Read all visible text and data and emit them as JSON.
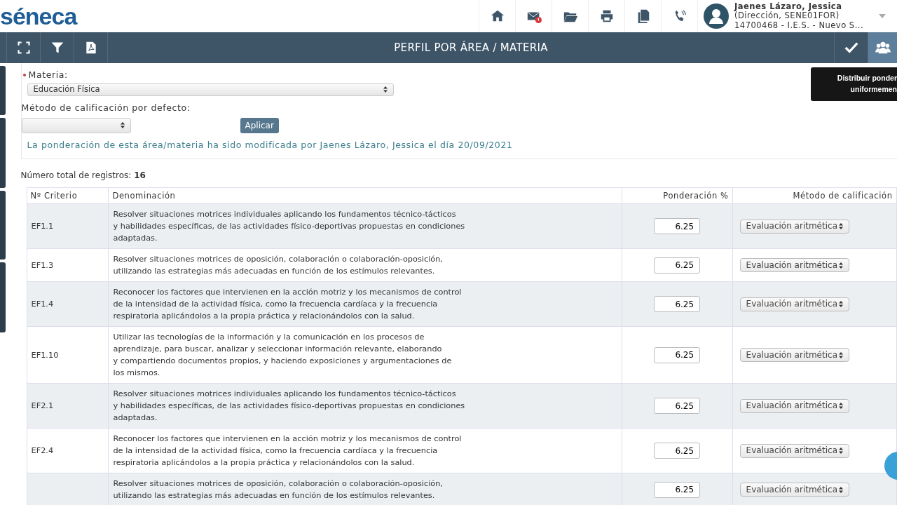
{
  "header": {
    "logo": "séneca",
    "icons": [
      {
        "kind": "home"
      },
      {
        "kind": "mail"
      },
      {
        "kind": "folder"
      },
      {
        "kind": "print"
      },
      {
        "kind": "copy"
      },
      {
        "kind": "phone"
      }
    ],
    "user": {
      "name": "Jaenes Lázaro, Jessica",
      "role": "(Dirección, SENE01FOR)",
      "center": "14700468 - I.E.S. - Nuevo S..."
    }
  },
  "toolbar": {
    "left_icons": [
      {
        "kind": "expand"
      },
      {
        "kind": "filter"
      },
      {
        "kind": "pdf"
      }
    ],
    "title": "PERFIL POR ÁREA / MATERIA",
    "right_icons": [
      {
        "kind": "check",
        "selected": false
      },
      {
        "kind": "users",
        "selected": true
      }
    ],
    "tooltip": [
      "Distribuir ponder",
      "uniformemen"
    ]
  },
  "form": {
    "materia_label": "Materia:",
    "materia_value": "Educación Física",
    "method_label": "Método de calificación por defecto:",
    "apply_button": "Aplicar",
    "notice": "La ponderación de esta área/materia ha sido modificada por Jaenes Lázaro, Jessica el día 20/09/2021"
  },
  "records": "Número total de registros: **16**",
  "table": {
    "columns": [
      "Nº Criterio",
      "Denominación",
      "Ponderación %",
      "Método de calificación"
    ],
    "rows": [
      {
        "criterio": "EF1.1",
        "denominacion": "Resolver situaciones motrices individuales aplicando los fundamentos técnico-tácticos\ny habilidades específicas, de las actividades físico-deportivas propuestas en condiciones\nadaptadas.",
        "ponderacion": "6.25",
        "metodo": "Evaluación aritmética"
      },
      {
        "criterio": "EF1.3",
        "denominacion": "Resolver situaciones motrices de oposición, colaboración o colaboración-oposición,\nutilizando las estrategias más adecuadas en función de los estímulos relevantes.",
        "ponderacion": "6.25",
        "metodo": "Evaluación aritmética"
      },
      {
        "criterio": "EF1.4",
        "denominacion": "Reconocer los factores que intervienen en la acción motriz y los mecanismos de control\nde la intensidad de la actividad física, como la frecuencia cardíaca y la frecuencia\nrespiratoria aplicándolos a la propia práctica y relacionándolos con la salud.",
        "ponderacion": "6.25",
        "metodo": "Evaluación aritmética"
      },
      {
        "criterio": "EF1.10",
        "denominacion": "Utilizar las tecnologías de la información y la comunicación en los procesos de\naprendizaje, para buscar, analizar y seleccionar información relevante, elaborando\ny compartiendo documentos propios, y haciendo exposiciones y argumentaciones de\nlos mismos.",
        "ponderacion": "6.25",
        "metodo": "Evaluación aritmética"
      },
      {
        "criterio": "EF2.1",
        "denominacion": "Resolver situaciones motrices individuales aplicando los fundamentos técnico-tácticos\ny habilidades específicas, de las actividades físico-deportivas propuestas en condiciones\nadaptadas.",
        "ponderacion": "6.25",
        "metodo": "Evaluación aritmética"
      },
      {
        "criterio": "EF2.4",
        "denominacion": "Reconocer los factores que intervienen en la acción motriz y los mecanismos de control\nde la intensidad de la actividad física, como la frecuencia cardíaca y la frecuencia\nrespiratoria aplicándolos a la propia práctica y relacionándolos con la salud.",
        "ponderacion": "6.25",
        "metodo": "Evaluación aritmética"
      },
      {
        "denominacion": "Resolver situaciones motrices de oposición, colaboración o colaboración-oposición,\nutilizando las estrategias más adecuadas en función de los estímulos relevantes.",
        "ponderacion": "6.25",
        "metodo": "Evaluación aritmética"
      }
    ]
  }
}
